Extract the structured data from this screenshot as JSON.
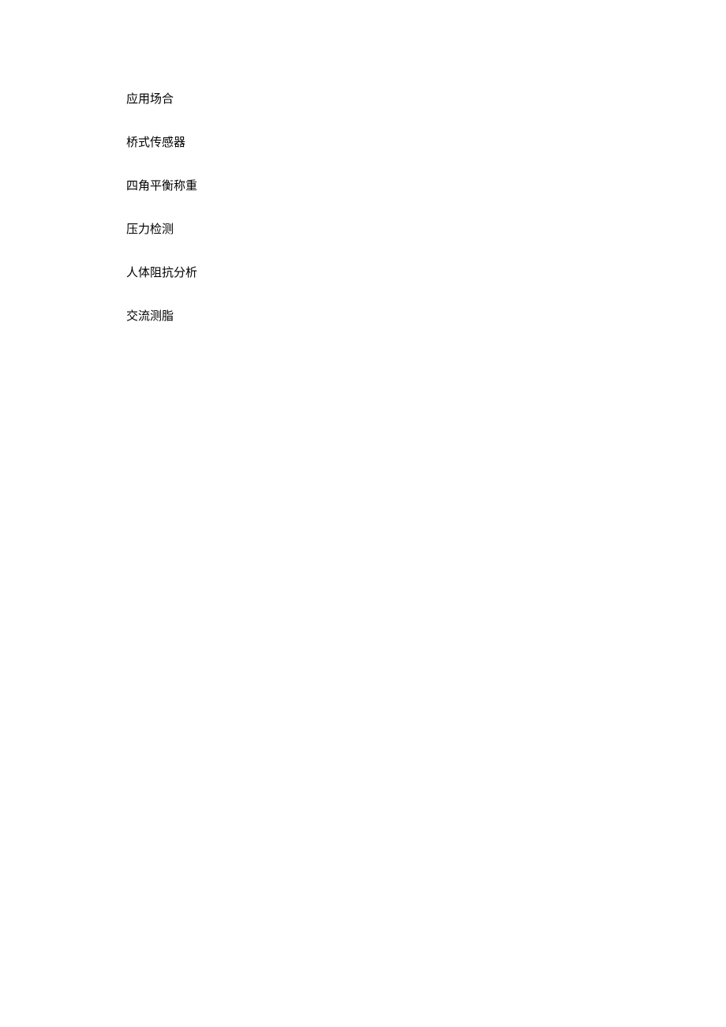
{
  "items": [
    "应用场合",
    "桥式传感器",
    "四角平衡称重",
    "压力检测",
    "人体阻抗分析",
    "交流测脂"
  ]
}
